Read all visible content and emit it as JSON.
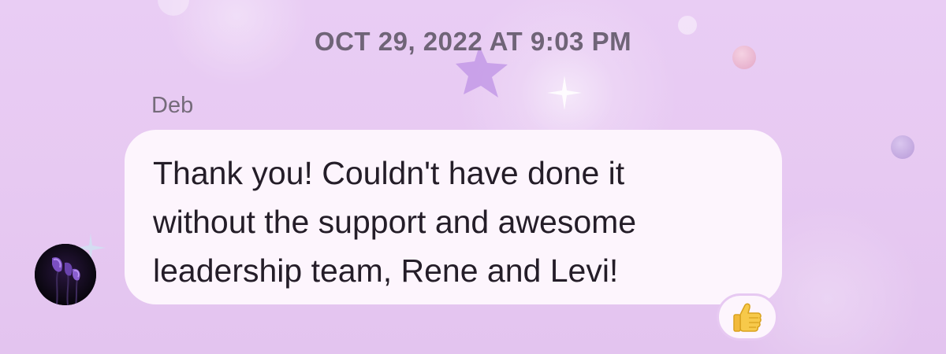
{
  "conversation": {
    "timestamp": "OCT 29, 2022 AT 9:03 PM",
    "message": {
      "sender": "Deb",
      "text": "Thank you! Couldn't have done it\nwithout the support and awesome\nleadership team, Rene and Levi!",
      "reaction_icon": "thumbs-up-icon"
    },
    "avatar_icon": "purple-calla-lily-icon"
  },
  "colors": {
    "background": "#e9cdf4",
    "bubble": "#fdf5fd",
    "text": "#241d28",
    "meta_text": "#6f6477"
  }
}
